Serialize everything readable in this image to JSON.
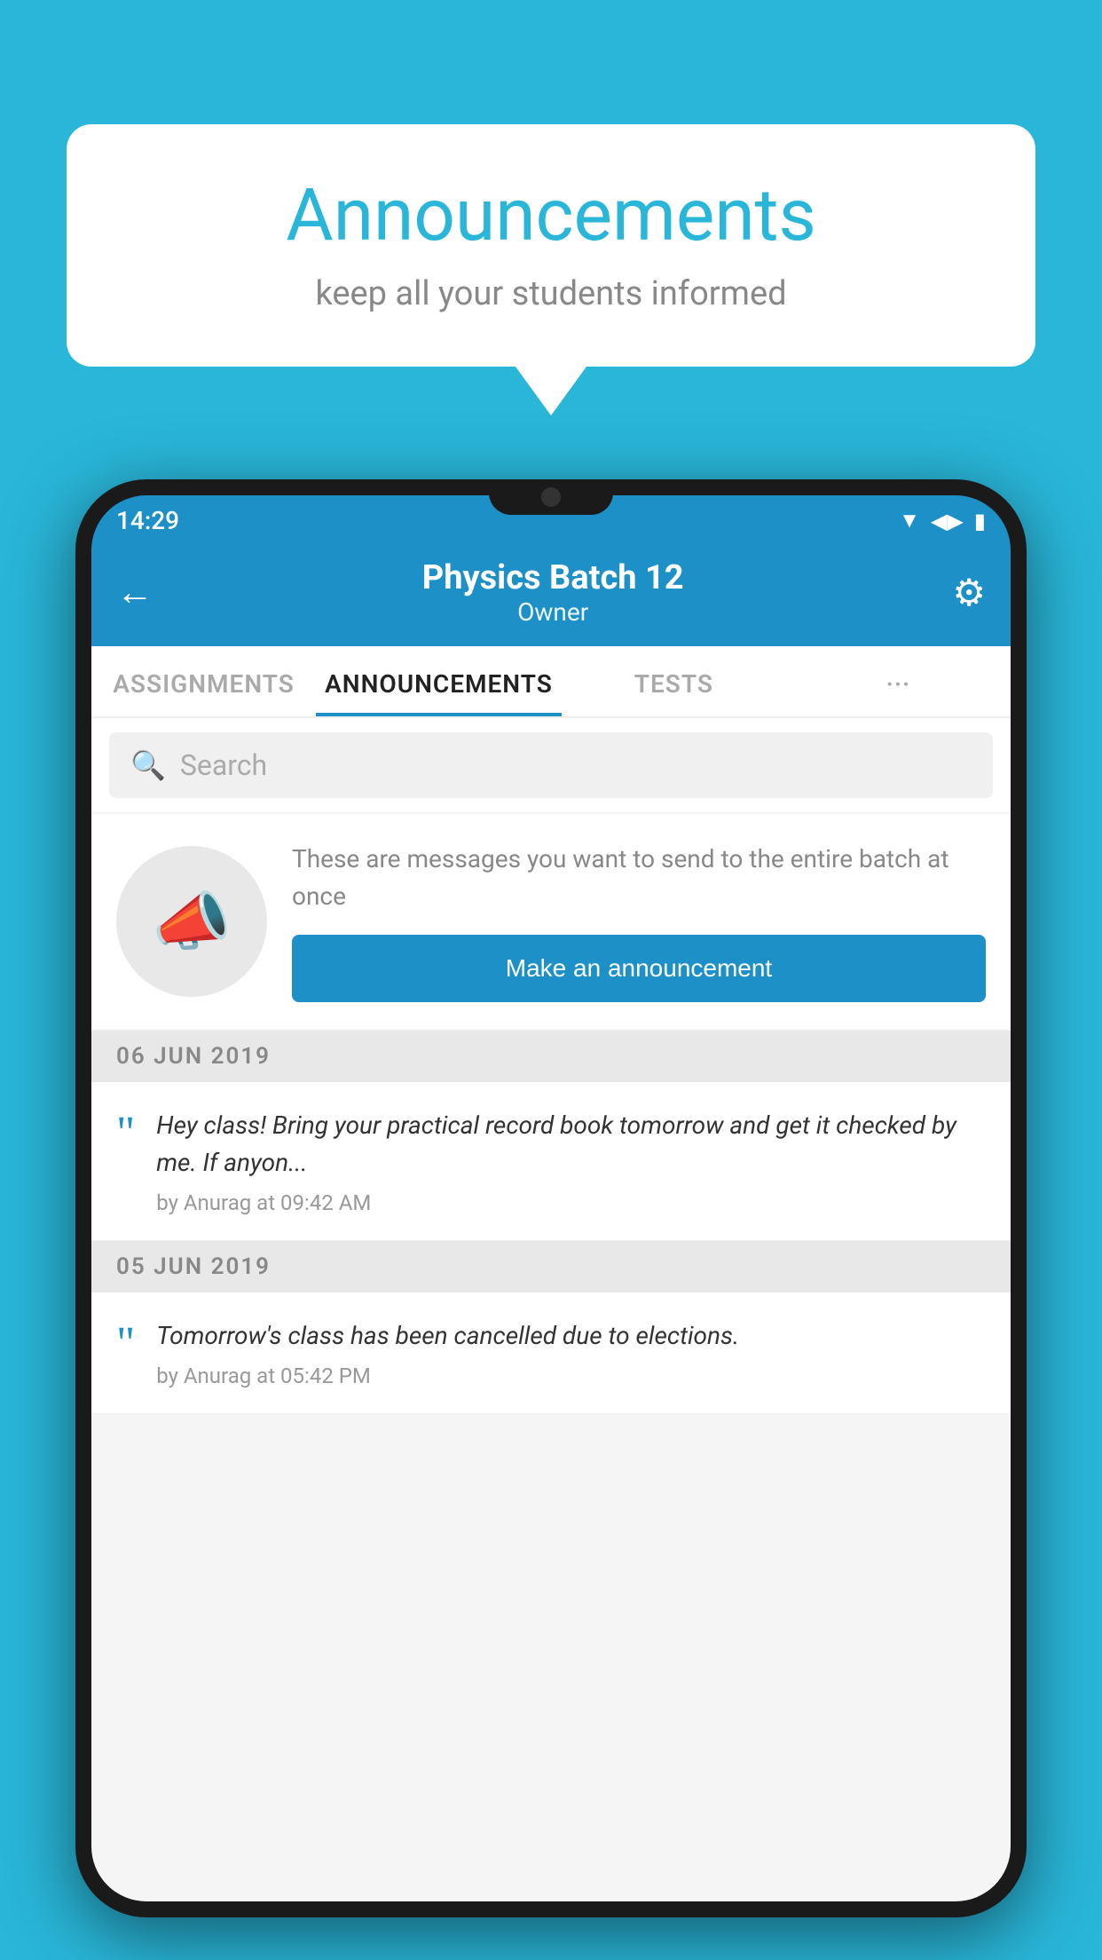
{
  "background_color": "#29b6d8",
  "speech_bubble": {
    "title": "Announcements",
    "subtitle": "keep all your students informed"
  },
  "phone": {
    "status_bar": {
      "time": "14:29",
      "wifi": "▲",
      "signal": "▲",
      "battery": "▮"
    },
    "header": {
      "title": "Physics Batch 12",
      "subtitle": "Owner",
      "back_label": "←",
      "gear_label": "⚙"
    },
    "tabs": [
      {
        "label": "ASSIGNMENTS",
        "active": false
      },
      {
        "label": "ANNOUNCEMENTS",
        "active": true
      },
      {
        "label": "TESTS",
        "active": false
      },
      {
        "label": "···",
        "active": false
      }
    ],
    "search": {
      "placeholder": "Search"
    },
    "promo": {
      "description": "These are messages you want to send to the entire batch at once",
      "button_label": "Make an announcement"
    },
    "announcements": [
      {
        "date": "06  JUN  2019",
        "messages": [
          {
            "text": "Hey class! Bring your practical record book tomorrow and get it checked by me. If anyon...",
            "meta": "by Anurag at 09:42 AM"
          }
        ]
      },
      {
        "date": "05  JUN  2019",
        "messages": [
          {
            "text": "Tomorrow's class has been cancelled due to elections.",
            "meta": "by Anurag at 05:42 PM"
          }
        ]
      }
    ]
  }
}
